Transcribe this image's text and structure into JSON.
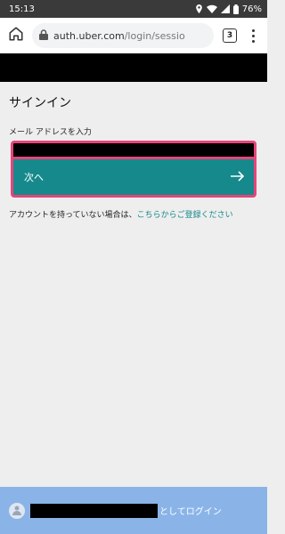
{
  "status_bar": {
    "time": "15:13",
    "battery": "76%"
  },
  "browser": {
    "url_host": "auth.uber.com",
    "url_path": "/login/sessio",
    "tab_count": "3"
  },
  "page": {
    "title": "サインイン",
    "email_label": "メール アドレスを入力",
    "email_value": "",
    "next_label": "次へ",
    "no_account_text": "アカウントを持っていない場合は、",
    "signup_link": "こちらからご登録ください"
  },
  "bottom_bar": {
    "login_as_suffix": "としてログイン"
  },
  "colors": {
    "accent": "#16898c",
    "highlight_border": "#e6457a",
    "bottom_bar": "#8ab4e8"
  }
}
